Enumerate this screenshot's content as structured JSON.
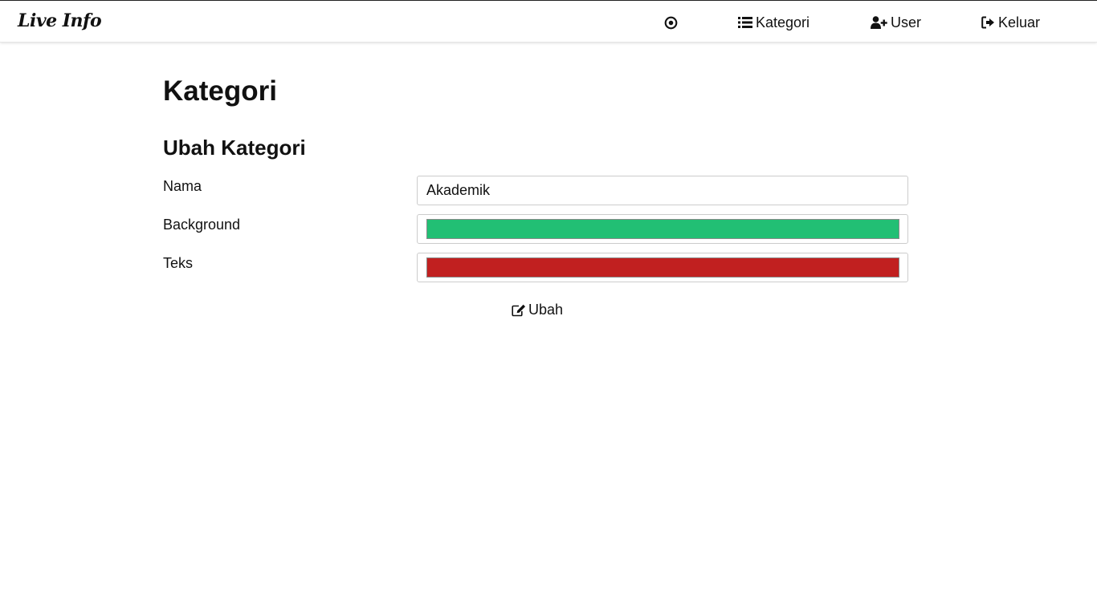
{
  "navbar": {
    "brand": "Live Info",
    "items": [
      {
        "label": "",
        "icon": "target-icon"
      },
      {
        "label": "Kategori",
        "icon": "list-icon"
      },
      {
        "label": "User",
        "icon": "user-plus-icon"
      },
      {
        "label": "Keluar",
        "icon": "sign-out-icon"
      }
    ]
  },
  "main": {
    "title": "Kategori",
    "form": {
      "title": "Ubah Kategori",
      "fields": {
        "nama": {
          "label": "Nama",
          "value": "Akademik"
        },
        "background": {
          "label": "Background",
          "value": "#22bf74"
        },
        "teks": {
          "label": "Teks",
          "value": "#c12020"
        }
      },
      "submit_label": "Ubah",
      "submit_icon": "edit-icon"
    }
  }
}
